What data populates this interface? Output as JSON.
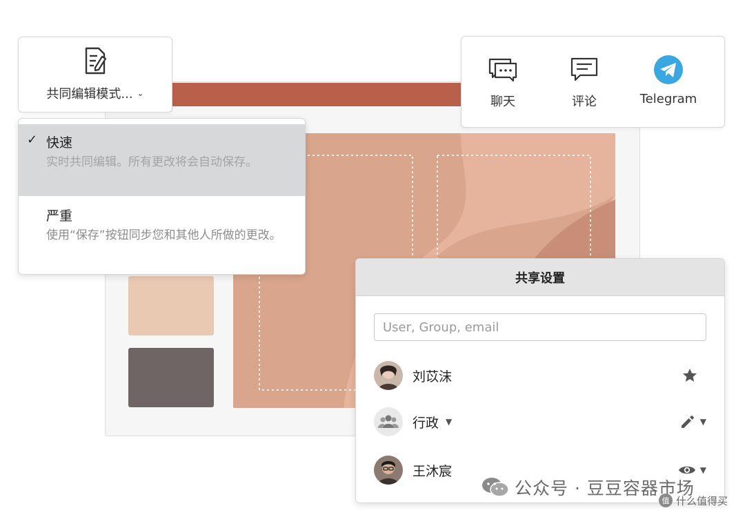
{
  "mode_button": {
    "label": "共同编辑模式...",
    "icon": "document-edit-icon"
  },
  "mode_menu": {
    "options": [
      {
        "title": "快速",
        "description": "实时共同编辑。所有更改将会自动保存。",
        "selected": true
      },
      {
        "title": "严重",
        "description": "使用“保存”按钮同步您和其他人所做的更改。",
        "selected": false
      }
    ]
  },
  "comms": {
    "items": [
      {
        "label": "聊天",
        "icon": "chat-icon"
      },
      {
        "label": "评论",
        "icon": "comment-icon"
      },
      {
        "label": "Telegram",
        "icon": "telegram-icon"
      }
    ],
    "telegram_color": "#3aa7e0"
  },
  "share": {
    "title": "共享设置",
    "search_placeholder": "User, Group, email",
    "users": [
      {
        "name": "刘苡沫",
        "permission_icon": "star-icon",
        "has_menu": false
      },
      {
        "name": "行政",
        "permission_icon": "pencil-icon",
        "has_menu": true,
        "is_group": true
      },
      {
        "name": "王沐宸",
        "permission_icon": "eye-icon",
        "has_menu": true
      }
    ]
  },
  "watermark": {
    "text": "公众号 · 豆豆容器市场",
    "sub": "什么值得买"
  },
  "colors": {
    "title_bar": "#b86049",
    "slide": "#d9a58c",
    "swatch_light": "#e9c9b2",
    "swatch_dark": "#6e6564"
  }
}
